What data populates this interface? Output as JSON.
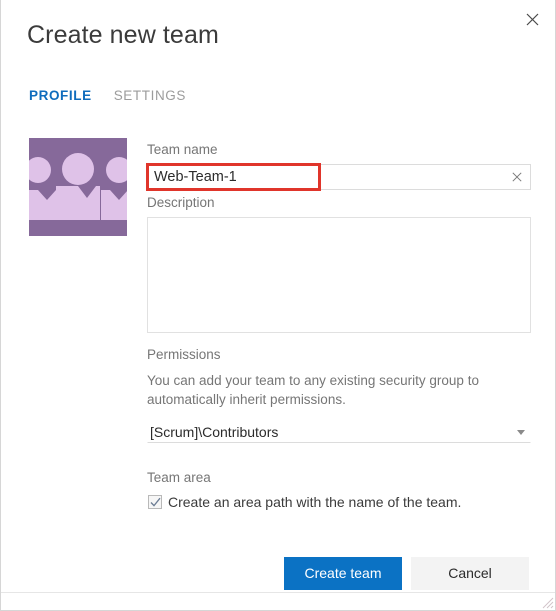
{
  "dialog": {
    "title": "Create new team",
    "close_icon": "close-icon"
  },
  "tabs": [
    {
      "label": "PROFILE",
      "active": true
    },
    {
      "label": "SETTINGS",
      "active": false
    }
  ],
  "avatar": {
    "icon": "team-people-avatar",
    "background_color": "#86699a",
    "figure_color": "#dfc2e8"
  },
  "form": {
    "team_name": {
      "label": "Team name",
      "value": "Web-Team-1",
      "placeholder": "",
      "clear_icon": "close-icon"
    },
    "description": {
      "label": "Description",
      "value": "",
      "placeholder": ""
    },
    "permissions": {
      "label": "Permissions",
      "help_text": "You can add your team to any existing security group to automatically inherit permissions.",
      "selected": "[Scrum]\\Contributors",
      "caret_icon": "chevron-down-icon"
    },
    "team_area": {
      "label": "Team area",
      "checkbox_label": "Create an area path with the name of the team.",
      "checked": true,
      "check_icon": "check-icon"
    }
  },
  "footer": {
    "primary_label": "Create team",
    "secondary_label": "Cancel"
  },
  "colors": {
    "accent": "#0b72c4",
    "tab_active": "#0f6cbd",
    "highlight_box": "#e0352b"
  }
}
